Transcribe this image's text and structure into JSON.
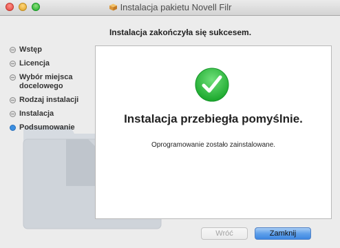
{
  "window": {
    "title": "Instalacja pakietu Novell Filr",
    "app_icon": "package-icon"
  },
  "heading": "Instalacja zakończyła się sukcesem.",
  "sidebar": {
    "steps": [
      {
        "label": "Wstęp",
        "state": "done"
      },
      {
        "label": "Licencja",
        "state": "done"
      },
      {
        "label": "Wybór miejsca docelowego",
        "state": "done"
      },
      {
        "label": "Rodzaj instalacji",
        "state": "done"
      },
      {
        "label": "Instalacja",
        "state": "done"
      },
      {
        "label": "Podsumowanie",
        "state": "current"
      }
    ]
  },
  "content": {
    "icon": "checkmark-icon",
    "success_title": "Instalacja przebiegła pomyślnie.",
    "message": "Oprogramowanie zostało zainstalowane."
  },
  "buttons": {
    "back_label": "Wróć",
    "close_label": "Zamknij"
  },
  "colors": {
    "accent": "#3b8fe2",
    "success_green": "#2dbb3a"
  }
}
